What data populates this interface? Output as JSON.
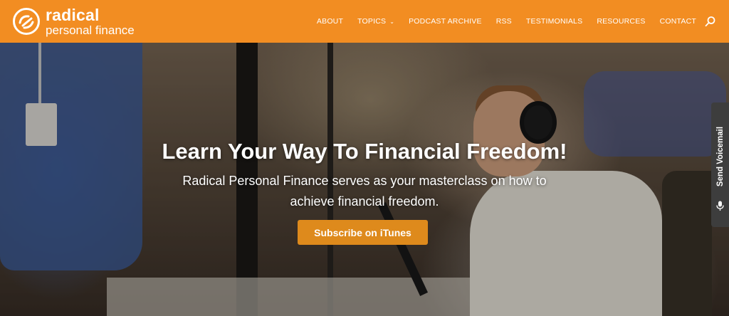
{
  "header": {
    "logo_line1": "radical",
    "logo_line2": "personal finance",
    "nav": [
      {
        "label": "ABOUT"
      },
      {
        "label": "TOPICS"
      },
      {
        "label": "PODCAST ARCHIVE"
      },
      {
        "label": "RSS"
      },
      {
        "label": "TESTIMONIALS"
      },
      {
        "label": "RESOURCES"
      },
      {
        "label": "CONTACT"
      }
    ],
    "search_icon": "search-icon",
    "brand_color": "#f28d22"
  },
  "hero": {
    "title": "Learn Your Way To Financial Freedom!",
    "subtitle": "Radical Personal Finance serves as your masterclass on how to achieve financial freedom.",
    "cta_label": "Subscribe on iTunes",
    "cta_color": "#de8a1c"
  },
  "voicemail": {
    "label": "Send Voicemail",
    "icon": "microphone-icon"
  }
}
